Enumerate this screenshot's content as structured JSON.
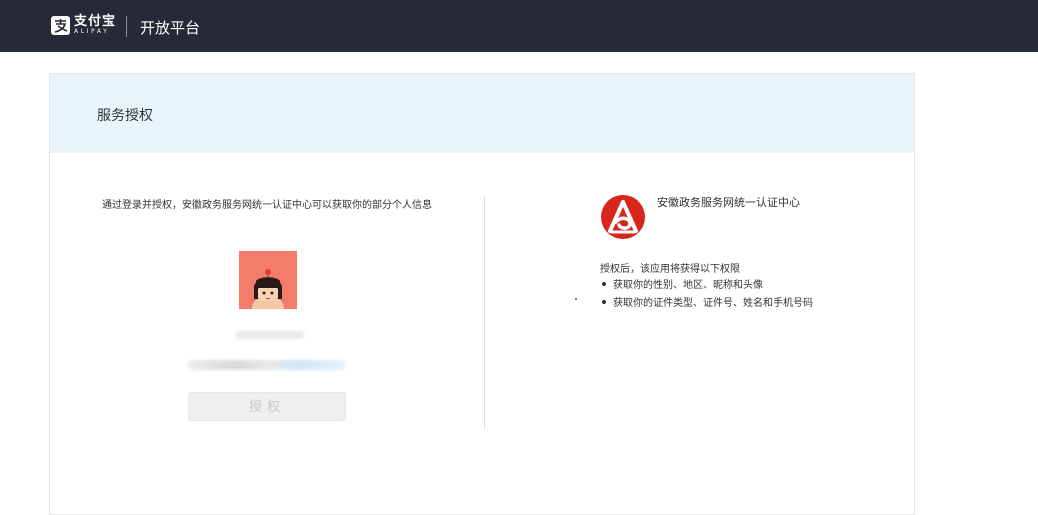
{
  "topbar": {
    "logo_cn": "支付宝",
    "logo_en": "ALIPAY",
    "title": "开放平台"
  },
  "card": {
    "title": "服务授权"
  },
  "left": {
    "intro": "通过登录并授权，安徽政务服务网统一认证中心可以获取你的部分个人信息",
    "authorize_button": "授权"
  },
  "right": {
    "org_name": "安徽政务服务网统一认证中心",
    "perm_intro": "授权后，该应用将获得以下权限",
    "permissions": [
      "获取你的性别、地区、昵称和头像",
      "获取你的证件类型、证件号、姓名和手机号码"
    ]
  },
  "colors": {
    "topbar": "#262a38",
    "header_bg": "#e8f4fc",
    "org_red": "#d9261c",
    "avatar_bg": "#f47c6a"
  }
}
